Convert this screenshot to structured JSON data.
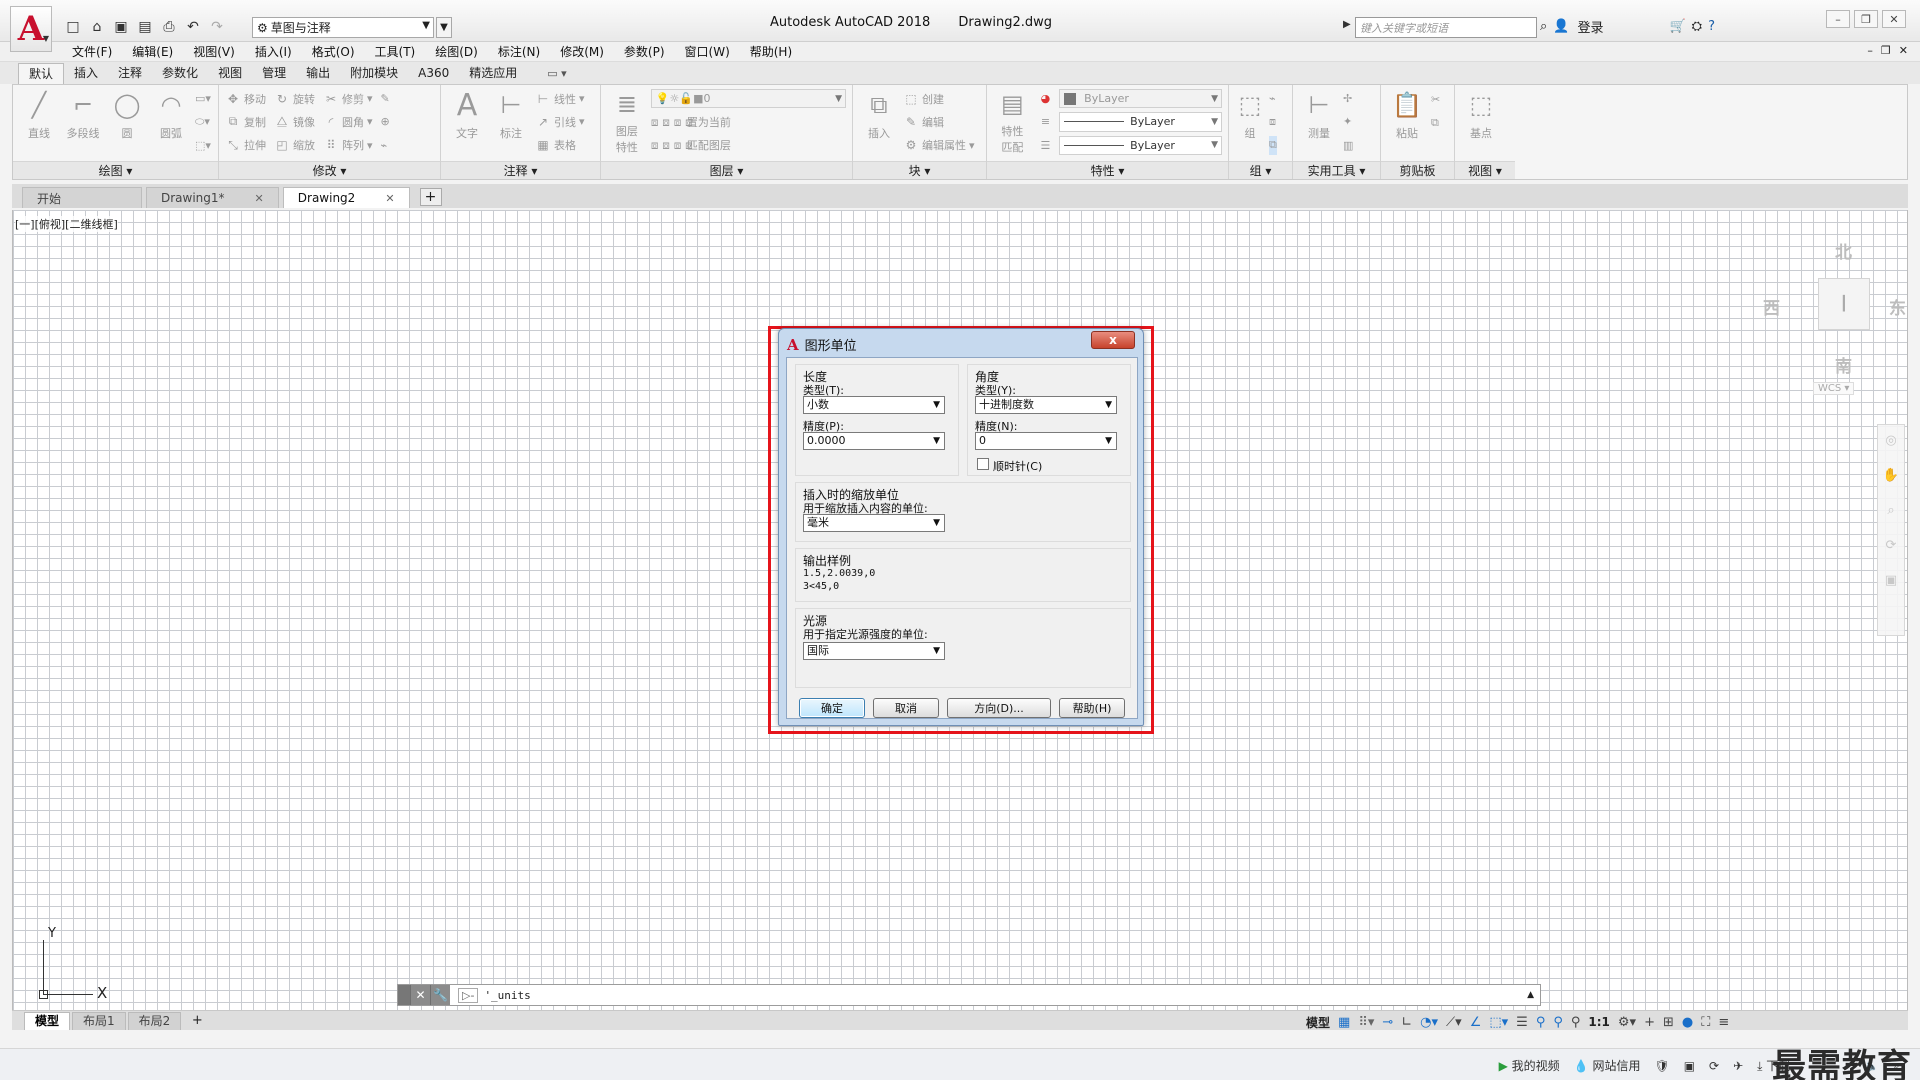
{
  "app": {
    "title": "Autodesk AutoCAD 2018",
    "file": "Drawing2.dwg",
    "logo_letter": "A",
    "workspace": "草图与注释",
    "search_placeholder": "键入关键字或短语",
    "login": "登录",
    "brand_color": "#c8102e"
  },
  "menubar": [
    "文件(F)",
    "编辑(E)",
    "视图(V)",
    "插入(I)",
    "格式(O)",
    "工具(T)",
    "绘图(D)",
    "标注(N)",
    "修改(M)",
    "参数(P)",
    "窗口(W)",
    "帮助(H)"
  ],
  "ribbon_tabs": [
    "默认",
    "插入",
    "注释",
    "参数化",
    "视图",
    "管理",
    "输出",
    "附加模块",
    "A360",
    "精选应用"
  ],
  "ribbon_active_tab": "默认",
  "ribbon": {
    "draw": {
      "title": "绘图",
      "tools": [
        "直线",
        "多段线",
        "圆",
        "圆弧"
      ]
    },
    "modify": {
      "title": "修改",
      "tools": [
        "移动",
        "旋转",
        "修剪",
        "复制",
        "镜像",
        "圆角",
        "拉伸",
        "缩放",
        "阵列"
      ]
    },
    "annotation": {
      "title": "注释",
      "tools": [
        "文字",
        "标注",
        "线性",
        "引线",
        "表格"
      ]
    },
    "layers": {
      "title": "图层",
      "tools": [
        "图层特性",
        "置为当前",
        "匹配图层"
      ],
      "current_layer": "0"
    },
    "block": {
      "title": "块",
      "tools": [
        "插入",
        "创建",
        "编辑",
        "编辑属性"
      ]
    },
    "properties": {
      "title": "特性",
      "tools": [
        "特性匹配"
      ],
      "color": "ByLayer",
      "linetype": "ByLayer",
      "lineweight": "ByLayer"
    },
    "groups": {
      "title": "组",
      "tools": [
        "组"
      ]
    },
    "utilities": {
      "title": "实用工具",
      "tools": [
        "测量"
      ]
    },
    "clipboard": {
      "title": "剪贴板",
      "tools": [
        "粘贴"
      ]
    },
    "view": {
      "title": "视图",
      "tools": [
        "基点"
      ]
    }
  },
  "file_tabs": [
    {
      "label": "开始",
      "closable": false,
      "active": false
    },
    {
      "label": "Drawing1*",
      "closable": true,
      "active": false
    },
    {
      "label": "Drawing2",
      "closable": true,
      "active": true
    }
  ],
  "viewport_label": "[一][俯视][二维线框]",
  "viewcube": {
    "north": "北",
    "south": "南",
    "east": "东",
    "west": "西",
    "wcs": "WCS"
  },
  "ucs": {
    "x": "X",
    "y": "Y"
  },
  "command_line": {
    "text": "'_units"
  },
  "layout_tabs": [
    {
      "label": "模型",
      "active": true
    },
    {
      "label": "布局1",
      "active": false
    },
    {
      "label": "布局2",
      "active": false
    }
  ],
  "statusbar": {
    "model": "模型",
    "scale": "1:1"
  },
  "bottom_strip": {
    "items": [
      "我的视频",
      "网站信用",
      "下载"
    ],
    "watermark": "最需教育"
  },
  "dialog": {
    "title": "图形单位",
    "close": "x",
    "length": {
      "title": "长度",
      "type_label": "类型(T):",
      "type_value": "小数",
      "precision_label": "精度(P):",
      "precision_value": "0.0000"
    },
    "angle": {
      "title": "角度",
      "type_label": "类型(Y):",
      "type_value": "十进制度数",
      "precision_label": "精度(N):",
      "precision_value": "0",
      "clockwise_label": "顺时针(C)",
      "clockwise_checked": false
    },
    "insertion": {
      "title": "插入时的缩放单位",
      "label": "用于缩放插入内容的单位:",
      "value": "毫米"
    },
    "sample": {
      "title": "输出样例",
      "line1": "1.5,2.0039,0",
      "line2": "3<45,0"
    },
    "lighting": {
      "title": "光源",
      "label": "用于指定光源强度的单位:",
      "value": "国际"
    },
    "buttons": {
      "ok": "确定",
      "cancel": "取消",
      "direction": "方向(D)...",
      "help": "帮助(H)"
    }
  }
}
